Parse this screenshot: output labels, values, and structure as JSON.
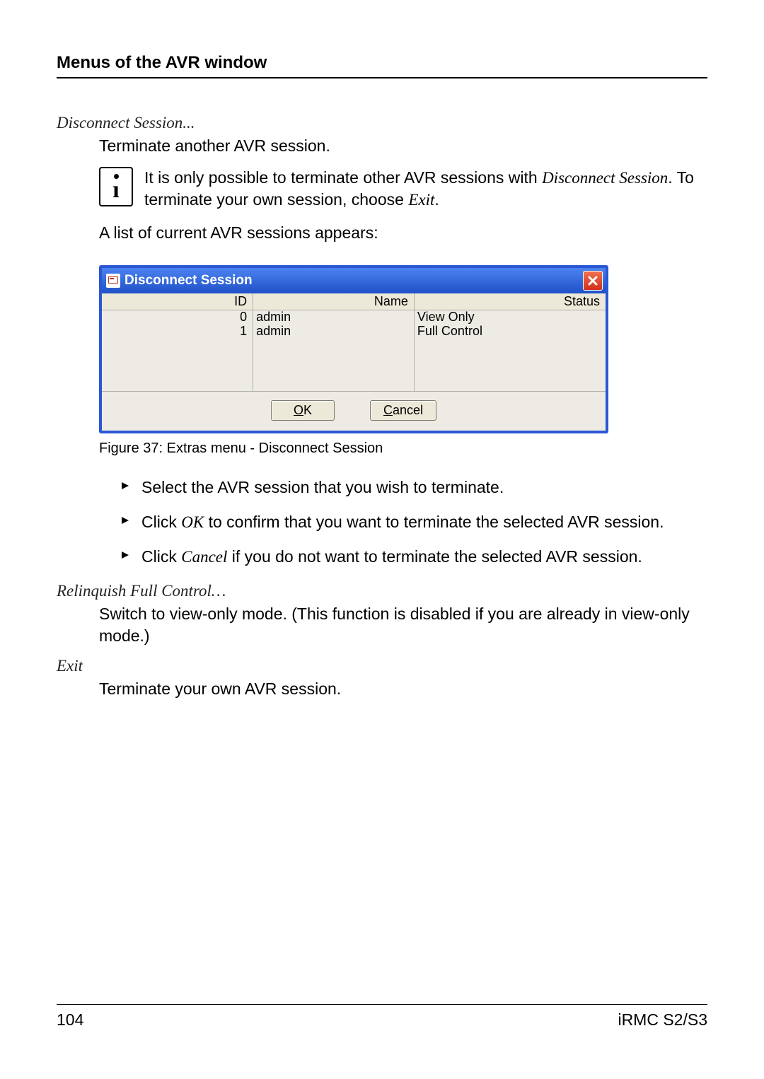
{
  "header": {
    "title": "Menus of the AVR window"
  },
  "sec1": {
    "head": "Disconnect Session...",
    "intro": "Terminate another AVR session.",
    "info_pre": "It is only possible to terminate other AVR sessions with ",
    "info_em": "Disconnect Session",
    "info_post": ". To terminate your own session, choose ",
    "info_em2": "Exit",
    "info_tail": ".",
    "list_intro": "A list of current AVR sessions appears:"
  },
  "dialog": {
    "title": "Disconnect Session",
    "columns": {
      "id": "ID",
      "name": "Name",
      "status": "Status"
    },
    "rows": [
      {
        "id": "0",
        "name": "admin",
        "status": "View Only"
      },
      {
        "id": "1",
        "name": "admin",
        "status": "Full Control"
      }
    ],
    "ok_u": "O",
    "ok_rest": "K",
    "cancel_u": "C",
    "cancel_rest": "ancel"
  },
  "caption": "Figure 37: Extras menu - Disconnect Session",
  "bullets": {
    "b1": "Select the AVR session that you wish to terminate.",
    "b2_pre": "Click ",
    "b2_em": "OK",
    "b2_post": " to confirm that you want to terminate the selected AVR session.",
    "b3_pre": "Click ",
    "b3_em": "Cancel",
    "b3_post": " if you do not want to terminate the selected AVR session."
  },
  "sec2": {
    "head": "Relinquish Full Control…",
    "body": "Switch to view-only mode. (This function is disabled if you are already in view-only mode.)"
  },
  "sec3": {
    "head": "Exit",
    "body": "Terminate your own AVR session."
  },
  "footer": {
    "page": "104",
    "doc": "iRMC S2/S3"
  }
}
